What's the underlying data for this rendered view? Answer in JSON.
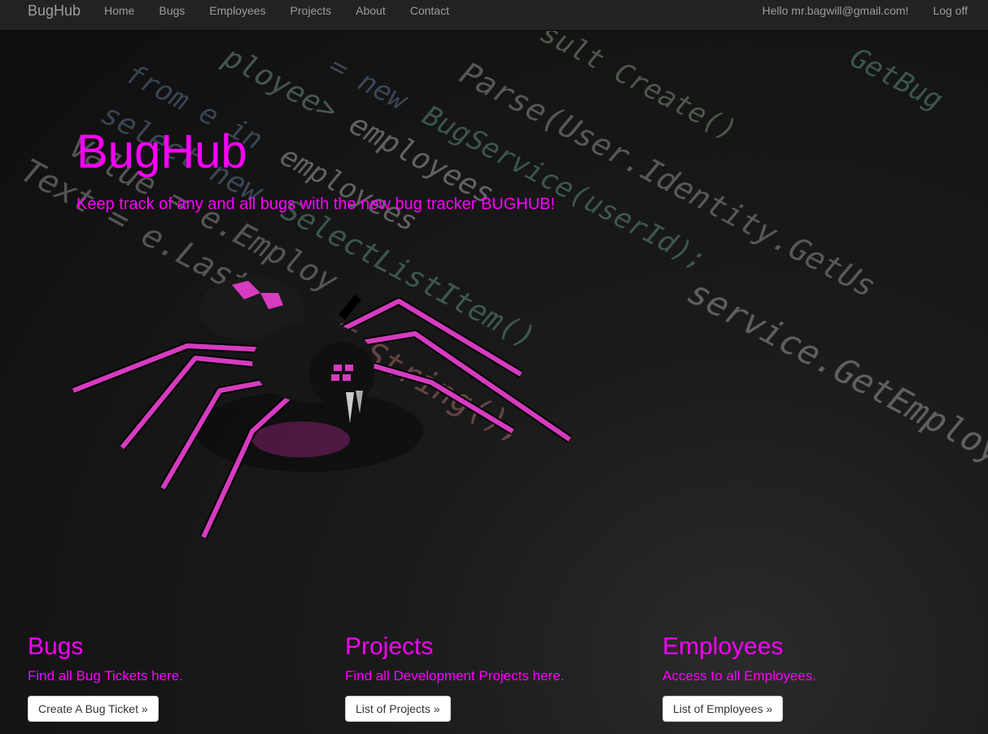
{
  "navbar": {
    "brand": "BugHub",
    "links": [
      "Home",
      "Bugs",
      "Employees",
      "Projects",
      "About",
      "Contact"
    ],
    "greeting": "Hello mr.bagwill@gmail.com!",
    "logoff": "Log off"
  },
  "hero": {
    "title": "BugHub",
    "tagline": "Keep track of any and all bugs with the new bug tracker BUGHUB!"
  },
  "columns": [
    {
      "heading": "Bugs",
      "text": "Find all Bug Tickets here.",
      "button": "Create A Bug Ticket »"
    },
    {
      "heading": "Projects",
      "text": "Find all Development Projects here.",
      "button": "List of Projects »"
    },
    {
      "heading": "Employees",
      "text": "Access to all Employees.",
      "button": "List of Employees »"
    }
  ],
  "colors": {
    "accent": "#ff00ff",
    "navbar_bg": "#222222",
    "nav_text": "#9d9d9d"
  }
}
